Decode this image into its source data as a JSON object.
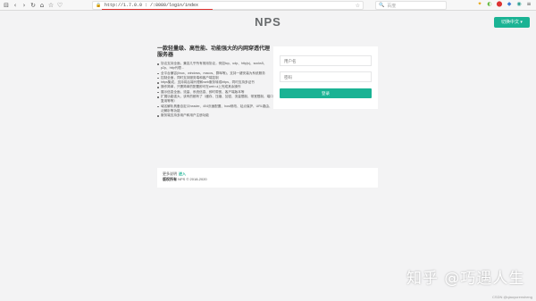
{
  "browser": {
    "nav_icons": [
      "⊟",
      "‹",
      "›",
      "↻",
      "⌂",
      "☆",
      "♡"
    ],
    "security_icon": "🔒",
    "url": "http://1.7.0.0 : /:8080/login/index",
    "bookmark_icon": "☆",
    "search_icon": "🔍",
    "search_placeholder": "百度",
    "right_icons": [
      "✦",
      "◐",
      "⬤",
      "◆",
      "◉",
      "≡"
    ]
  },
  "brand": "NPS",
  "lang_button": "切换中文 ▾",
  "intro": {
    "heading": "一款轻量级、高性能、功能强大的内网穿透代理服务器",
    "features": [
      "协议支持全面，兼容几乎所有常用协议，例如tcp、udp、http(s)、socks5、p2p、http代理…",
      "全平台兼容(linux、windows、macos、群晖等)，支持一键安装为系统服务",
      "控制全面，同时支持服务端和客户端控制",
      "https集成，支持将后端代理和web服务转成https，同时支持多证书",
      "操作简单，只需简单的配置即可在web ui上完成其余操作",
      "展示信息全面，流量、系统信息、即时带宽、客户端版本等",
      "扩展功能强大，该有的都有了（缓存、压缩、加密、流量限制、带宽限制、端口复用等等）",
      "域名解析具备自定义header、404页面配置、host修改、站点保护、URL路由、泛解析等功能",
      "服务端支持多用户和用户注册功能"
    ]
  },
  "login": {
    "username_placeholder": "用户名",
    "password_placeholder": "密码",
    "submit": "登录"
  },
  "footer": {
    "more_text": "更多说明",
    "more_link": "进入",
    "copyright_label": "版权所有",
    "copyright_text": "NPS © 2018-2020"
  },
  "watermark": "知乎 @巧遇人生",
  "credit": "CSDN @qiaoyurensheng",
  "colors": {
    "accent": "#1ab394",
    "page_bg": "#f3f3f4",
    "url_underline": "#e0312f"
  }
}
